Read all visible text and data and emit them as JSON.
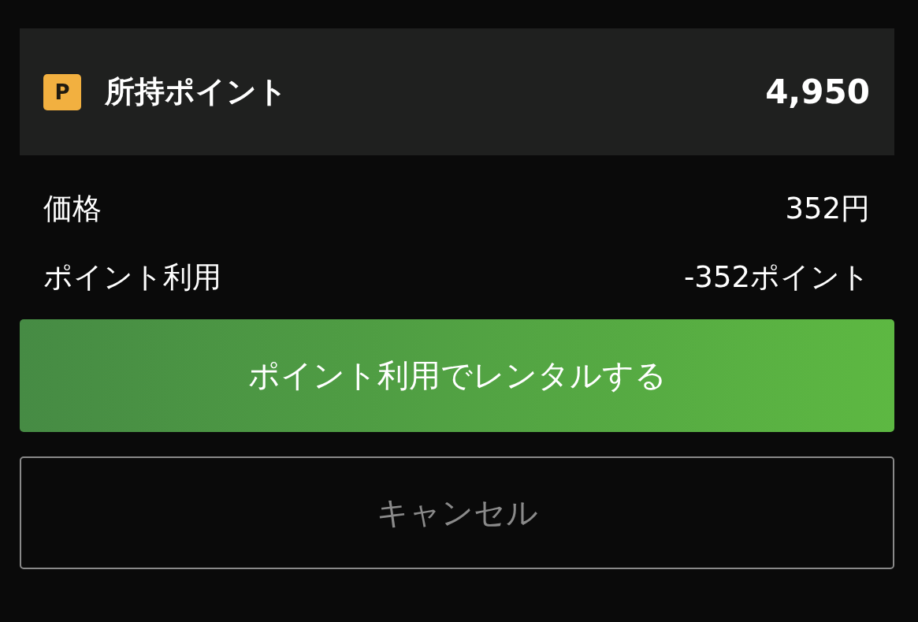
{
  "points_card": {
    "icon_letter": "P",
    "label": "所持ポイント",
    "value": "4,950"
  },
  "summary_rows": [
    {
      "label": "価格",
      "value": "352円"
    },
    {
      "label": "ポイント利用",
      "value": "-352ポイント"
    }
  ],
  "buttons": [
    {
      "kind": "primary",
      "label": "ポイント利用でレンタルする"
    },
    {
      "kind": "secondary",
      "label": "キャンセル"
    }
  ]
}
